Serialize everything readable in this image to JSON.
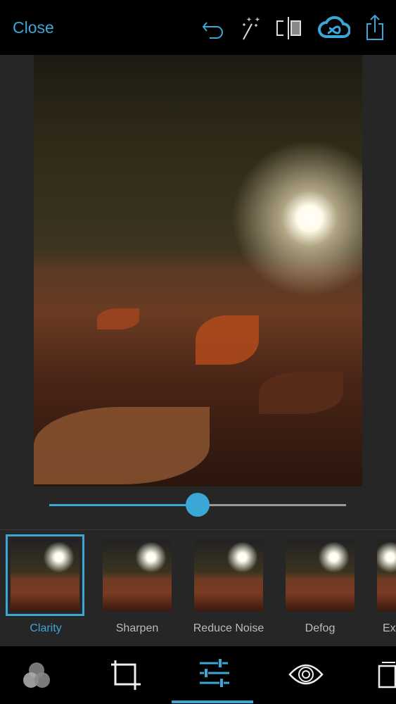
{
  "header": {
    "close_label": "Close",
    "icons": [
      "undo-icon",
      "magic-wand-icon",
      "compare-icon",
      "creative-cloud-icon",
      "share-icon"
    ]
  },
  "slider": {
    "value": 0.5
  },
  "adjustments": [
    {
      "label": "Clarity",
      "selected": true
    },
    {
      "label": "Sharpen"
    },
    {
      "label": "Reduce Noise"
    },
    {
      "label": "Defog"
    },
    {
      "label": "Ex"
    }
  ],
  "toolbar": {
    "icons": [
      "looks-icon",
      "crop-icon",
      "adjustments-icon",
      "eye-icon",
      "borders-icon"
    ],
    "active": "adjustments-icon"
  },
  "colors": {
    "accent": "#3aa7d6"
  }
}
